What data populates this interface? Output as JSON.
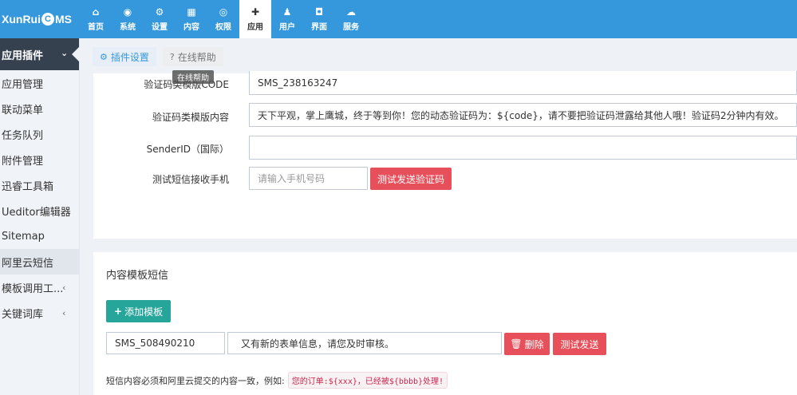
{
  "header": {
    "logo": {
      "pre": "XunRui",
      "mark": "C",
      "post": "MS"
    },
    "nav": [
      {
        "label": "首页",
        "icon": "home-icon",
        "glyph": "⌂"
      },
      {
        "label": "系统",
        "icon": "globe-icon",
        "glyph": "◉"
      },
      {
        "label": "设置",
        "icon": "cogs-icon",
        "glyph": "⚙"
      },
      {
        "label": "内容",
        "icon": "grid-icon",
        "glyph": "▦"
      },
      {
        "label": "权限",
        "icon": "user-circle-icon",
        "glyph": "◎"
      },
      {
        "label": "应用",
        "icon": "puzzle-icon",
        "glyph": "✚",
        "active": true
      },
      {
        "label": "用户",
        "icon": "user-icon",
        "glyph": "♟"
      },
      {
        "label": "界面",
        "icon": "html5-icon",
        "glyph": "◘"
      },
      {
        "label": "服务",
        "icon": "cloud-icon",
        "glyph": "☁"
      }
    ]
  },
  "sidebar": {
    "head": "应用插件",
    "items": [
      {
        "label": "应用管理"
      },
      {
        "label": "联动菜单"
      },
      {
        "label": "任务队列"
      },
      {
        "label": "附件管理"
      },
      {
        "label": "迅睿工具箱"
      },
      {
        "label": "Ueditor编辑器"
      },
      {
        "label": "Sitemap"
      },
      {
        "label": "阿里云短信",
        "active": true
      },
      {
        "label": "模板调用工...",
        "caret": "‹"
      },
      {
        "label": "关键词库",
        "caret": "‹"
      }
    ]
  },
  "toolbar": {
    "settings_label": "插件设置",
    "help_label": "在线帮助",
    "tooltip": "在线帮助"
  },
  "form": {
    "code_label": "验证码类模版CODE",
    "code_value": "SMS_238163247",
    "content_label": "验证码类模版内容",
    "content_value": "天下平观，掌上鹰城，终于等到你！您的动态验证码为：${code}，请不要把验证码泄露给其他人哦！验证码2分钟内有效。",
    "sender_label": "SenderID（国际）",
    "sender_value": "",
    "phone_label": "测试短信接收手机",
    "phone_placeholder": "请输入手机号码",
    "send_test_label": "测试发送验证码"
  },
  "content_section": {
    "title": "内容模板短信",
    "add_label": "添加模板",
    "template_code": "SMS_508490210",
    "template_text": "又有新的表单信息，请您及时审核。",
    "delete_label": "删除",
    "test_label": "测试发送",
    "hint_text": "短信内容必须和阿里云提交的内容一致，例如:",
    "hint_example": "您的订单:${xxx}，已经被${bbbb}处理!"
  },
  "colors": {
    "header": "#3598dc",
    "sidebar_head": "#364150",
    "danger": "#e7505a",
    "success": "#26a69a"
  }
}
